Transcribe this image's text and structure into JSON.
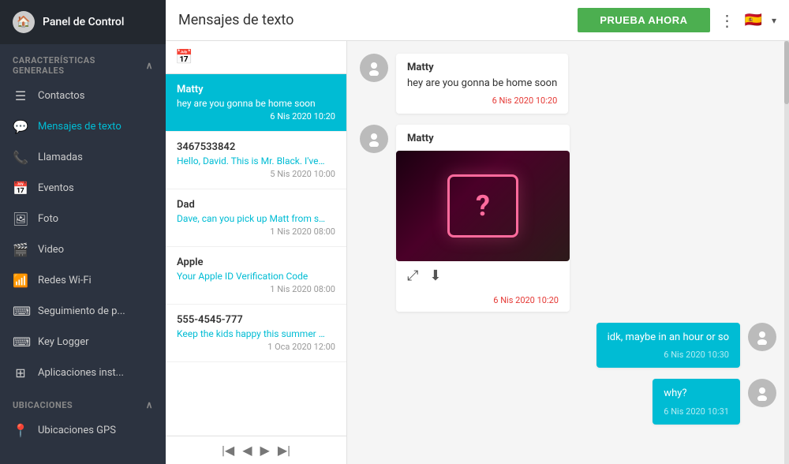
{
  "sidebar": {
    "header": {
      "title": "Panel de Control",
      "icon": "🏠"
    },
    "sections": [
      {
        "label": "CARACTERÍSTICAS GENERALES",
        "items": [
          {
            "id": "contactos",
            "label": "Contactos",
            "icon": "☰"
          },
          {
            "id": "mensajes",
            "label": "Mensajes de texto",
            "icon": "💬",
            "active": true
          },
          {
            "id": "llamadas",
            "label": "Llamadas",
            "icon": "📞"
          },
          {
            "id": "eventos",
            "label": "Eventos",
            "icon": "📅"
          },
          {
            "id": "foto",
            "label": "Foto",
            "icon": "🖼"
          },
          {
            "id": "video",
            "label": "Video",
            "icon": "🎬"
          },
          {
            "id": "redes",
            "label": "Redes Wi-Fi",
            "icon": "📶"
          },
          {
            "id": "seguimiento",
            "label": "Seguimiento de p...",
            "icon": "⌨"
          },
          {
            "id": "keylogger",
            "label": "Key Logger",
            "icon": "⌨"
          },
          {
            "id": "apps",
            "label": "Aplicaciones inst...",
            "icon": "⊞"
          }
        ]
      },
      {
        "label": "UBICACIONES",
        "items": [
          {
            "id": "ubicaciones",
            "label": "Ubicaciones GPS",
            "icon": "📍"
          }
        ]
      }
    ]
  },
  "topbar": {
    "title": "Mensajes de texto",
    "button_label": "PRUEBA AHORA",
    "menu_icon": "⋮",
    "flag": "🇪🇸"
  },
  "message_list": {
    "items": [
      {
        "name": "Matty",
        "preview": "hey are you gonna be home soon",
        "time": "6 Nis 2020 10:20",
        "selected": true
      },
      {
        "name": "3467533842",
        "preview": "Hello, David. This is Mr. Black. I've noti...",
        "time": "5 Nis 2020 10:00",
        "selected": false
      },
      {
        "name": "Dad",
        "preview": "Dave, can you pick up Matt from schoo...",
        "time": "1 Nis 2020 08:00",
        "selected": false
      },
      {
        "name": "Apple",
        "preview": "Your Apple ID Verification Code",
        "time": "1 Nis 2020 08:00",
        "selected": false
      },
      {
        "name": "555-4545-777",
        "preview": "Keep the kids happy this summer with ...",
        "time": "1 Oca 2020 12:00",
        "selected": false
      }
    ],
    "pagination": {
      "first": "|◀",
      "prev": "◀",
      "next": "▶",
      "last": "▶|"
    }
  },
  "chat": {
    "messages": [
      {
        "type": "received",
        "sender": "Matty",
        "text": "hey are you gonna be home soon",
        "time": "6 Nis 2020 10:20",
        "has_avatar": true
      },
      {
        "type": "received",
        "sender": "Matty",
        "text": "",
        "has_image": true,
        "time": "6 Nis 2020 10:20",
        "has_avatar": true
      },
      {
        "type": "sent",
        "text": "idk, maybe in an hour or so",
        "time": "6 Nis 2020 10:30",
        "has_avatar": true
      },
      {
        "type": "sent",
        "text": "why?",
        "time": "6 Nis 2020 10:31",
        "has_avatar": true
      }
    ]
  }
}
